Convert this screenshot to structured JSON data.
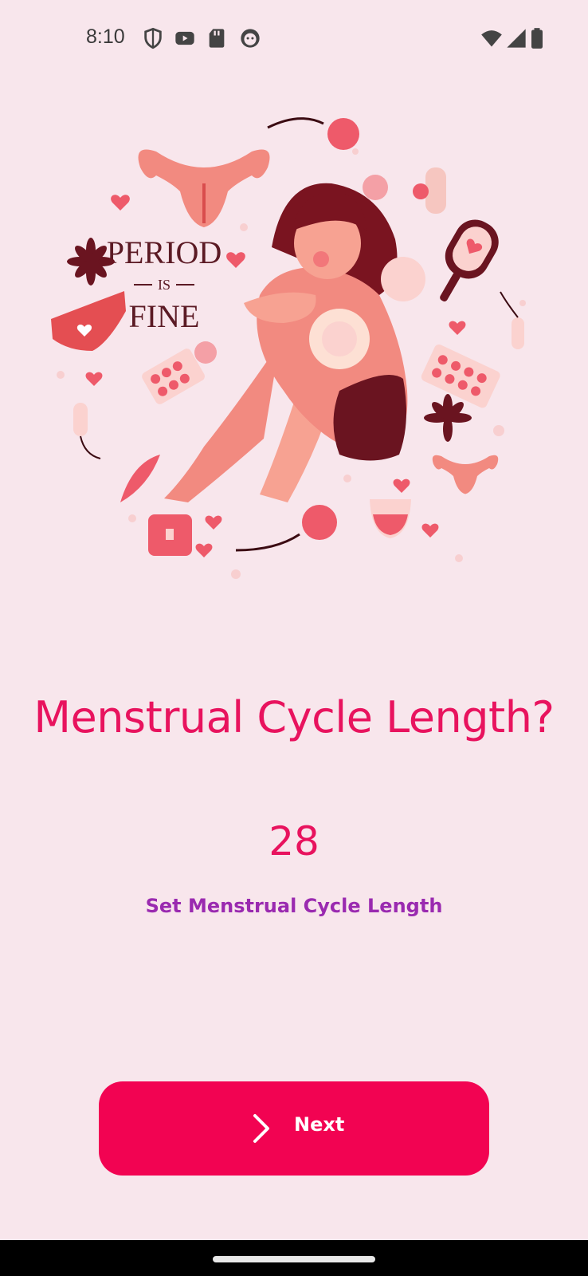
{
  "status_bar": {
    "time": "8:10",
    "left_icons": [
      "shield-icon",
      "youtube-icon",
      "sd-card-icon",
      "face-icon"
    ],
    "right_icons": [
      "wifi-icon",
      "cellular-signal-icon",
      "battery-icon"
    ]
  },
  "illustration": {
    "badge_line1": "PERIOD",
    "badge_line2": "IS",
    "badge_line3": "FINE"
  },
  "main": {
    "title": "Menstrual Cycle Length?",
    "value": "28",
    "set_link": "Set Menstrual Cycle Length"
  },
  "next_button": {
    "label": "Next",
    "icon": "chevron-right-icon"
  },
  "colors": {
    "background": "#f8e6ec",
    "accent": "#e8135e",
    "button": "#f20352",
    "link": "#9a2ab0"
  }
}
